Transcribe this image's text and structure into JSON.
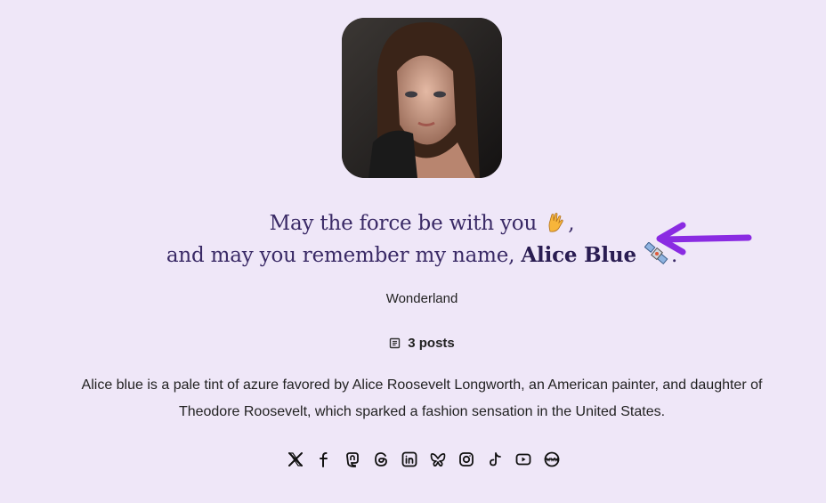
{
  "profile": {
    "avatar_alt": "Alice Blue",
    "tagline_line1": "May the force be with you",
    "tagline_line1_end": ",",
    "tagline_line2_prefix": "and may you remember my name,",
    "name": "Alice Blue",
    "tagline_line2_end": ".",
    "location": "Wonderland",
    "posts_count": "3 posts",
    "bio_line1": "Alice blue is a pale tint of azure favored by Alice Roosevelt Longworth, an American painter, and daughter of",
    "bio_line2": "Theodore Roosevelt, which sparked a fashion sensation in the United States."
  },
  "colors": {
    "background": "#efe7f8",
    "tagline": "#3a2a66",
    "arrow": "#8a2be2"
  },
  "social_links": [
    {
      "icon": "x-icon"
    },
    {
      "icon": "facebook-icon"
    },
    {
      "icon": "mastodon-icon"
    },
    {
      "icon": "threads-icon"
    },
    {
      "icon": "linkedin-icon"
    },
    {
      "icon": "bluesky-icon"
    },
    {
      "icon": "instagram-icon"
    },
    {
      "icon": "tiktok-icon"
    },
    {
      "icon": "youtube-icon"
    },
    {
      "icon": "website-icon"
    }
  ]
}
